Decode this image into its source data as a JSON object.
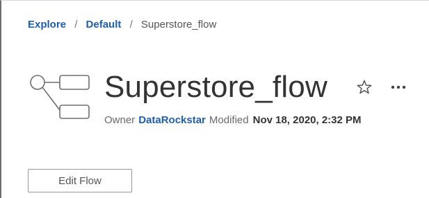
{
  "breadcrumb": {
    "items": [
      {
        "label": "Explore"
      },
      {
        "label": "Default"
      },
      {
        "label": "Superstore_flow"
      }
    ],
    "separator": "/"
  },
  "header": {
    "title": "Superstore_flow",
    "favorite_icon": "star-outline-icon",
    "more_icon": "more-actions-icon",
    "more_label": "···"
  },
  "meta": {
    "owner_label": "Owner",
    "owner_name": "DataRockstar",
    "modified_label": "Modified",
    "modified_date": "Nov 18, 2020, 2:32 PM"
  },
  "actions": {
    "edit_label": "Edit Flow"
  },
  "colors": {
    "link": "#1f5fa8",
    "text": "#333333",
    "muted": "#6a6a6a"
  }
}
